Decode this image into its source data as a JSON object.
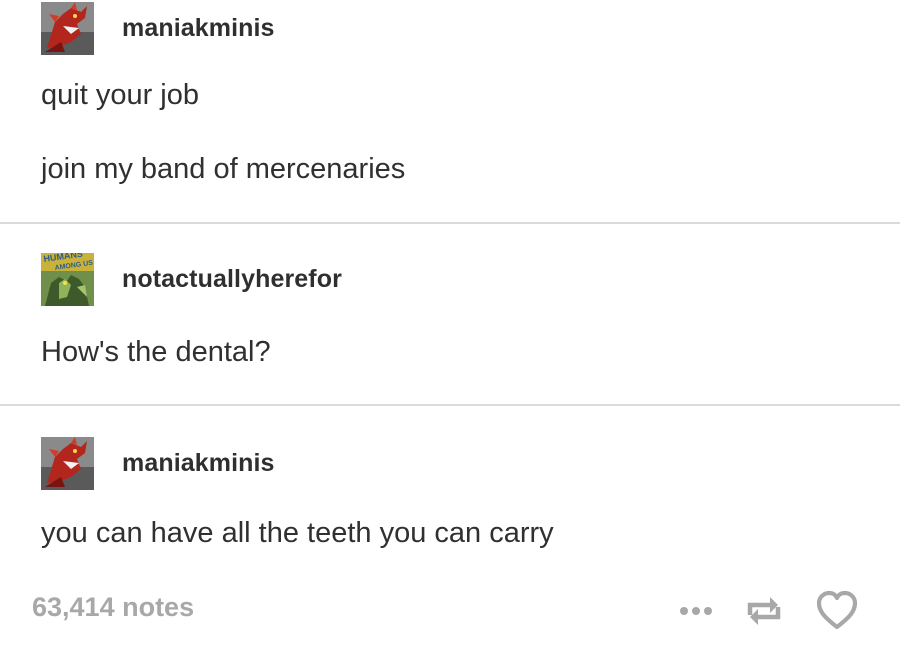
{
  "posts": [
    {
      "username": "maniakminis",
      "avatar": "red-dragon-avatar",
      "lines": [
        "quit your job",
        "join my band of mercenaries"
      ]
    },
    {
      "username": "notactuallyherefor",
      "avatar": "comic-cover-avatar",
      "lines": [
        "How's the dental?"
      ]
    },
    {
      "username": "maniakminis",
      "avatar": "red-dragon-avatar",
      "lines": [
        "you can have all the teeth you can carry"
      ]
    }
  ],
  "footer": {
    "notes": "63,414 notes",
    "actions": [
      "more-icon",
      "reblog-icon",
      "heart-icon"
    ]
  },
  "colors": {
    "text": "#303030",
    "muted": "#a8a8a8",
    "divider": "#dadada",
    "background": "#ffffff"
  }
}
